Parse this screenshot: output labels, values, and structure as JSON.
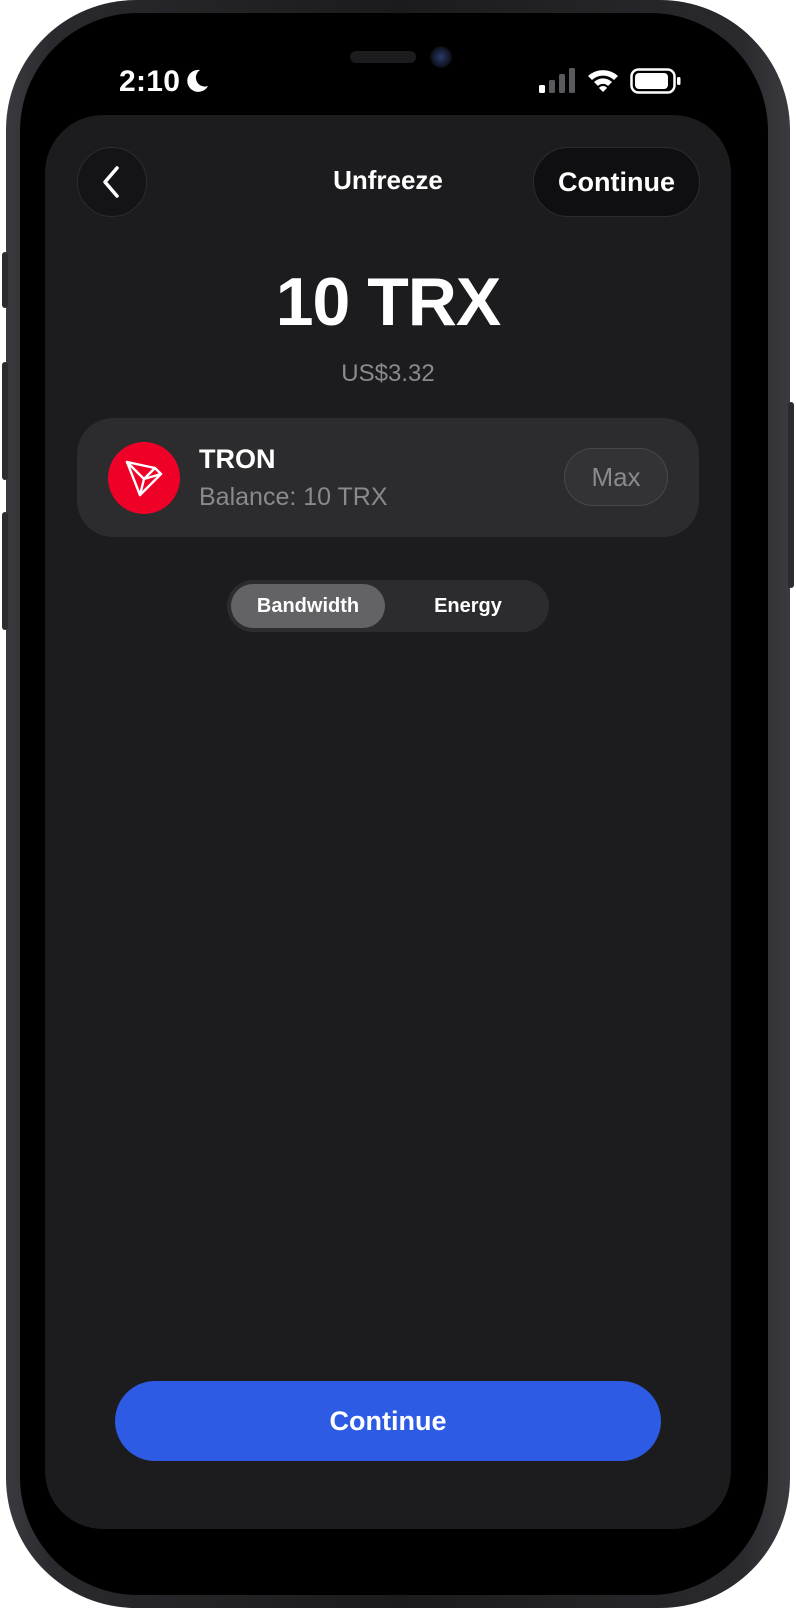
{
  "status_bar": {
    "time": "2:10"
  },
  "header": {
    "title": "Unfreeze",
    "continue_label": "Continue"
  },
  "amount": {
    "value": "10 TRX",
    "fiat": "US$3.32"
  },
  "asset": {
    "name": "TRON",
    "balance": "Balance: 10 TRX",
    "max_label": "Max",
    "brand_color": "#EF0027"
  },
  "resource_toggle": {
    "options": [
      "Bandwidth",
      "Energy"
    ],
    "selected": "Bandwidth"
  },
  "footer": {
    "continue_label": "Continue",
    "accent_color": "#2D5BE3"
  }
}
